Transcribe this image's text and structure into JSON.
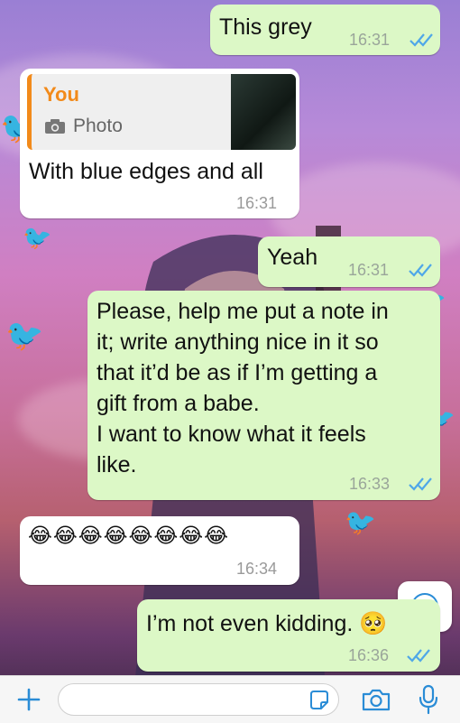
{
  "colors": {
    "outgoing_bubble": "#dcf8c6",
    "incoming_bubble": "#ffffff",
    "read_ticks": "#4fa7e8",
    "quote_accent": "#f28a1a",
    "icon_blue": "#2a8cd6"
  },
  "messages": [
    {
      "direction": "out",
      "text": "This grey",
      "time": "16:31",
      "status": "read"
    },
    {
      "direction": "in",
      "quote": {
        "author": "You",
        "type_icon": "camera-icon",
        "type_label": "Photo"
      },
      "text": "With blue edges and all",
      "time": "16:31"
    },
    {
      "direction": "out",
      "text": "Yeah",
      "time": "16:31",
      "status": "read"
    },
    {
      "direction": "out",
      "lines": [
        "Please, help me put a note in",
        "it; write anything nice in it so",
        "that it’d be as if I’m getting a",
        "gift from a babe.",
        "I want to know what it feels",
        "like."
      ],
      "time": "16:33",
      "status": "read"
    },
    {
      "direction": "in",
      "text": "😂😂😂😂😂😂😂😂",
      "time": "16:34"
    },
    {
      "direction": "out",
      "text": "I’m not even kidding. 🥺",
      "time": "16:36",
      "status": "read"
    }
  ],
  "icons": {
    "scroll_down": "chevron-down-icon",
    "attach": "plus-icon",
    "sticker": "sticker-icon",
    "camera": "camera-icon",
    "mic": "microphone-icon"
  }
}
